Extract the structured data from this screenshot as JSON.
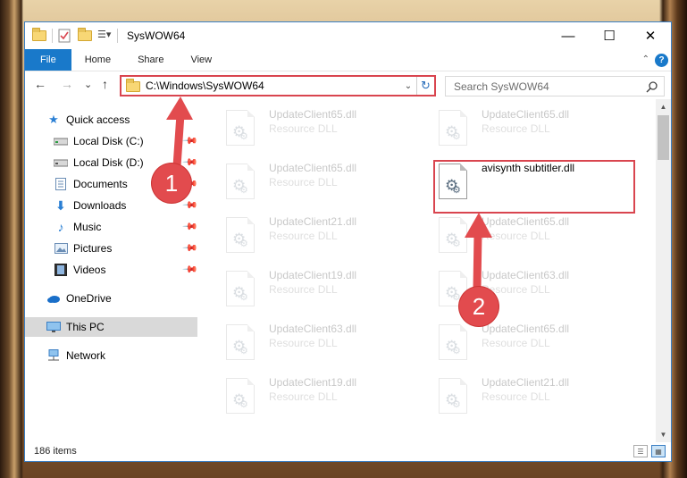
{
  "window": {
    "title": "SysWOW64",
    "controls": {
      "minimize": "—",
      "maximize": "☐",
      "close": "✕"
    }
  },
  "ribbon": {
    "tabs": [
      "File",
      "Home",
      "Share",
      "View"
    ],
    "help": "?",
    "collapse": "⌃"
  },
  "address": {
    "path": "C:\\Windows\\SysWOW64",
    "dropdown": "⌄",
    "refresh": "↻"
  },
  "search": {
    "placeholder": "Search SysWOW64",
    "icon": "search-icon"
  },
  "nav": {
    "back": "←",
    "forward": "→",
    "recent": "⌄",
    "up": "↑",
    "items": [
      {
        "label": "Quick access",
        "icon": "star-icon",
        "pinned": false
      },
      {
        "label": "Local Disk (C:)",
        "icon": "drive-icon",
        "pinned": true
      },
      {
        "label": "Local Disk (D:)",
        "icon": "drive-icon",
        "pinned": true
      },
      {
        "label": "Documents",
        "icon": "documents-icon",
        "pinned": true
      },
      {
        "label": "Downloads",
        "icon": "downloads-icon",
        "pinned": true
      },
      {
        "label": "Music",
        "icon": "music-icon",
        "pinned": true
      },
      {
        "label": "Pictures",
        "icon": "pictures-icon",
        "pinned": true
      },
      {
        "label": "Videos",
        "icon": "videos-icon",
        "pinned": true
      },
      {
        "label": "OneDrive",
        "icon": "cloud-icon",
        "pinned": false
      },
      {
        "label": "This PC",
        "icon": "monitor-icon",
        "pinned": false,
        "selected": true
      },
      {
        "label": "Network",
        "icon": "network-icon",
        "pinned": false
      }
    ]
  },
  "files": [
    {
      "name": "UpdateClient65.dll",
      "type": "Resource DLL",
      "faded": true
    },
    {
      "name": "UpdateClient65.dll",
      "type": "Resource DLL",
      "faded": true
    },
    {
      "name": "UpdateClient65.dll",
      "type": "Resource DLL",
      "faded": true
    },
    {
      "name": "avisynth subtitler.dll",
      "type": "",
      "faded": false,
      "highlighted": true
    },
    {
      "name": "UpdateClient21.dll",
      "type": "Resource DLL",
      "faded": true
    },
    {
      "name": "UpdateClient65.dll",
      "type": "Resource DLL",
      "faded": true
    },
    {
      "name": "UpdateClient19.dll",
      "type": "Resource DLL",
      "faded": true
    },
    {
      "name": "UpdateClient63.dll",
      "type": "Resource DLL",
      "faded": true
    },
    {
      "name": "UpdateClient63.dll",
      "type": "Resource DLL",
      "faded": true
    },
    {
      "name": "UpdateClient65.dll",
      "type": "Resource DLL",
      "faded": true
    },
    {
      "name": "UpdateClient19.dll",
      "type": "Resource DLL",
      "faded": true
    },
    {
      "name": "UpdateClient21.dll",
      "type": "Resource DLL",
      "faded": true
    }
  ],
  "status": {
    "count": "186 items"
  },
  "annotations": {
    "step1": "1",
    "step2": "2",
    "color": "#e24b4e"
  }
}
